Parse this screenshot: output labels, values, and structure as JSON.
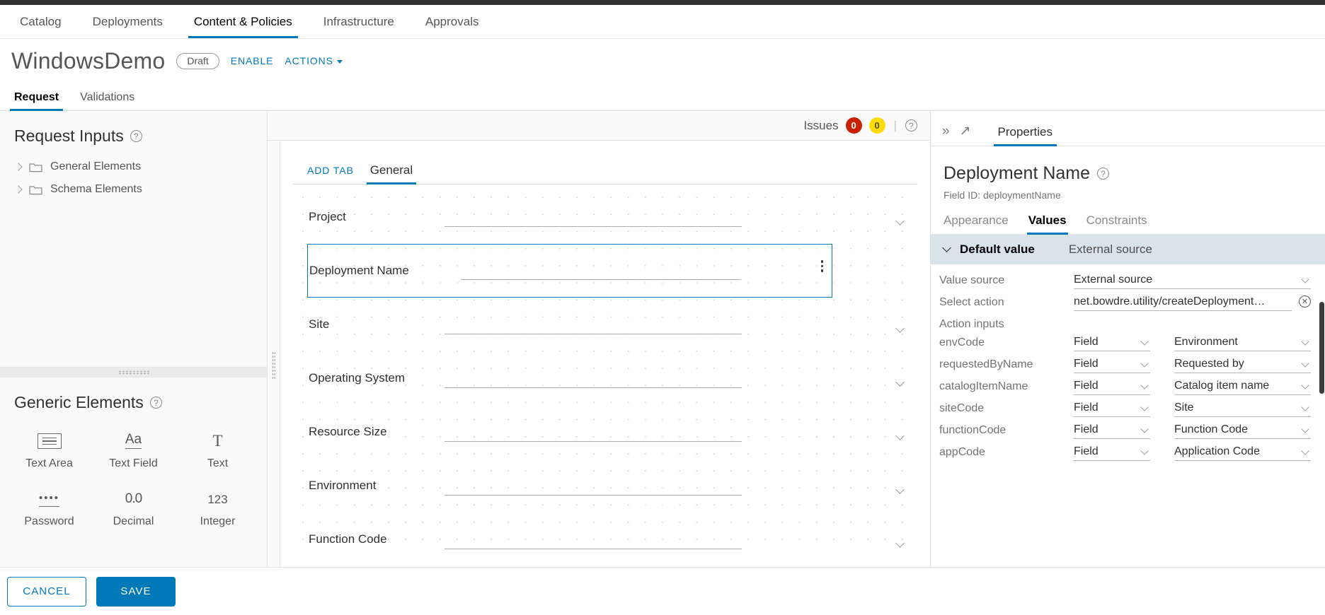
{
  "nav": {
    "items": [
      {
        "label": "Catalog",
        "active": false
      },
      {
        "label": "Deployments",
        "active": false
      },
      {
        "label": "Content & Policies",
        "active": true
      },
      {
        "label": "Infrastructure",
        "active": false
      },
      {
        "label": "Approvals",
        "active": false
      }
    ]
  },
  "header": {
    "title": "WindowsDemo",
    "status_badge": "Draft",
    "enable_label": "ENABLE",
    "actions_label": "ACTIONS"
  },
  "subtabs": [
    {
      "label": "Request",
      "active": true
    },
    {
      "label": "Validations",
      "active": false
    }
  ],
  "left_panel": {
    "request_inputs_title": "Request Inputs",
    "tree": [
      {
        "label": "General Elements"
      },
      {
        "label": "Schema Elements"
      }
    ],
    "generic_elements_title": "Generic Elements",
    "palette": [
      {
        "label": "Text Area",
        "icon": "text-area-icon"
      },
      {
        "label": "Text Field",
        "icon": "text-field-icon"
      },
      {
        "label": "Text",
        "icon": "text-icon"
      },
      {
        "label": "Password",
        "icon": "password-icon"
      },
      {
        "label": "Decimal",
        "icon": "decimal-icon"
      },
      {
        "label": "Integer",
        "icon": "integer-icon"
      }
    ]
  },
  "canvas": {
    "issues_label": "Issues",
    "issues_error_count": "0",
    "issues_warning_count": "0",
    "add_tab_label": "ADD TAB",
    "tabs": [
      {
        "label": "General",
        "active": true
      }
    ],
    "fields": [
      {
        "label": "Project",
        "type": "select",
        "selected": false
      },
      {
        "label": "Deployment Name",
        "type": "text",
        "selected": true
      },
      {
        "label": "Site",
        "type": "select",
        "selected": false
      },
      {
        "label": "Operating System",
        "type": "select",
        "selected": false
      },
      {
        "label": "Resource Size",
        "type": "select",
        "selected": false
      },
      {
        "label": "Environment",
        "type": "select",
        "selected": false
      },
      {
        "label": "Function Code",
        "type": "select",
        "selected": false
      }
    ]
  },
  "properties": {
    "panel_tab": "Properties",
    "field_title": "Deployment Name",
    "field_id_text": "Field ID: deploymentName",
    "tabs": [
      {
        "label": "Appearance",
        "active": false
      },
      {
        "label": "Values",
        "active": true
      },
      {
        "label": "Constraints",
        "active": false
      }
    ],
    "accordion_title": "Default value",
    "accordion_subtitle": "External source",
    "value_source_label": "Value source",
    "value_source_value": "External source",
    "select_action_label": "Select action",
    "select_action_value": "net.bowdre.utility/createDeployment…",
    "action_inputs_label": "Action inputs",
    "action_inputs": [
      {
        "name": "envCode",
        "binding_type": "Field",
        "binding_value": "Environment"
      },
      {
        "name": "requestedByName",
        "binding_type": "Field",
        "binding_value": "Requested by"
      },
      {
        "name": "catalogItemName",
        "binding_type": "Field",
        "binding_value": "Catalog item name"
      },
      {
        "name": "siteCode",
        "binding_type": "Field",
        "binding_value": "Site"
      },
      {
        "name": "functionCode",
        "binding_type": "Field",
        "binding_value": "Function Code"
      },
      {
        "name": "appCode",
        "binding_type": "Field",
        "binding_value": "Application Code"
      }
    ]
  },
  "footer": {
    "cancel_label": "CANCEL",
    "save_label": "SAVE"
  },
  "colors": {
    "accent": "#0079b8",
    "error": "#c92100",
    "warning": "#ffdc0b",
    "accordion_bg": "#d9e4ea"
  }
}
